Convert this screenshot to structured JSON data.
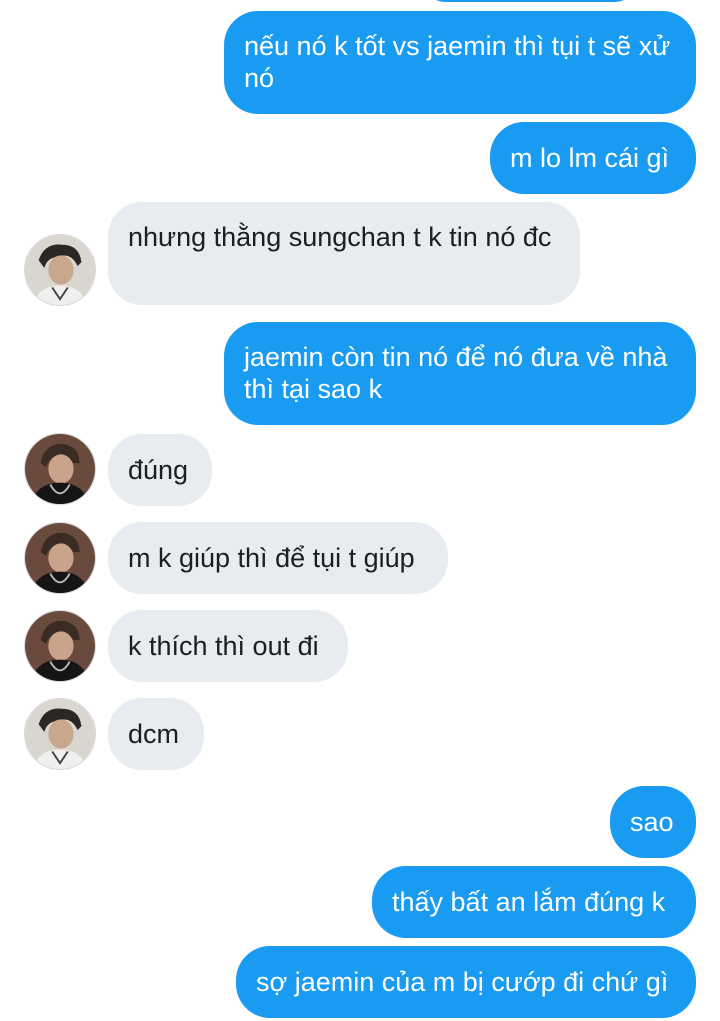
{
  "colors": {
    "outgoing_bubble": "#1a9bf2",
    "incoming_bubble": "#e8ebef",
    "background": "#ffffff"
  },
  "messages": [
    {
      "from": "me",
      "text": "nếu nó k tốt vs jaemin thì tụi t sẽ xử nó"
    },
    {
      "from": "me",
      "text": "m lo lm cái gì"
    },
    {
      "from": "them",
      "text": "nhưng thằng sungchan t k tin nó đc",
      "avatar": "avatar-light-icon"
    },
    {
      "from": "me",
      "text": "jaemin còn tin nó để nó đưa về nhà thì tại sao k"
    },
    {
      "from": "them",
      "text": "đúng",
      "avatar": "avatar-dark-icon"
    },
    {
      "from": "them",
      "text": "m k giúp thì để tụi t giúp",
      "avatar": "avatar-dark-icon"
    },
    {
      "from": "them",
      "text": "k thích thì out đi",
      "avatar": "avatar-dark-icon"
    },
    {
      "from": "them",
      "text": "dcm",
      "avatar": "avatar-light-icon"
    },
    {
      "from": "me",
      "text": "sao"
    },
    {
      "from": "me",
      "text": "thấy bất an lắm đúng k"
    },
    {
      "from": "me",
      "text": "sợ jaemin của m bị cướp đi chứ gì"
    }
  ]
}
